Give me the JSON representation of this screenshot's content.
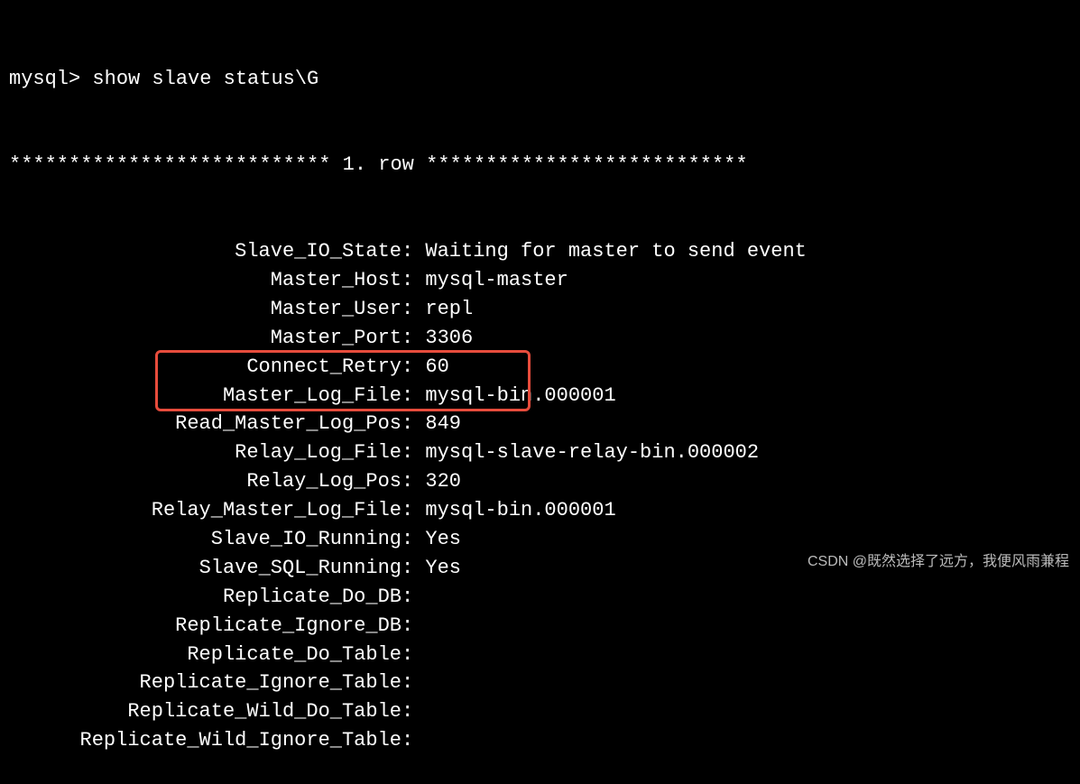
{
  "prompt": "mysql> ",
  "command": "show slave status\\G",
  "row_sep_left": "*************************** ",
  "row_number": "1. row",
  "row_sep_right": " ***************************",
  "rows": [
    {
      "label": "Slave_IO_State",
      "value": "Waiting for master to send event"
    },
    {
      "label": "Master_Host",
      "value": "mysql-master"
    },
    {
      "label": "Master_User",
      "value": "repl"
    },
    {
      "label": "Master_Port",
      "value": "3306"
    },
    {
      "label": "Connect_Retry",
      "value": "60"
    },
    {
      "label": "Master_Log_File",
      "value": "mysql-bin.000001"
    },
    {
      "label": "Read_Master_Log_Pos",
      "value": "849"
    },
    {
      "label": "Relay_Log_File",
      "value": "mysql-slave-relay-bin.000002"
    },
    {
      "label": "Relay_Log_Pos",
      "value": "320"
    },
    {
      "label": "Relay_Master_Log_File",
      "value": "mysql-bin.000001"
    },
    {
      "label": "Slave_IO_Running",
      "value": "Yes"
    },
    {
      "label": "Slave_SQL_Running",
      "value": "Yes"
    },
    {
      "label": "Replicate_Do_DB",
      "value": ""
    },
    {
      "label": "Replicate_Ignore_DB",
      "value": ""
    },
    {
      "label": "Replicate_Do_Table",
      "value": ""
    },
    {
      "label": "Replicate_Ignore_Table",
      "value": ""
    },
    {
      "label": "Replicate_Wild_Do_Table",
      "value": ""
    },
    {
      "label": "Replicate_Wild_Ignore_Table",
      "value": ""
    }
  ],
  "colon": ": ",
  "watermark": "CSDN @既然选择了远方，我便风雨兼程"
}
